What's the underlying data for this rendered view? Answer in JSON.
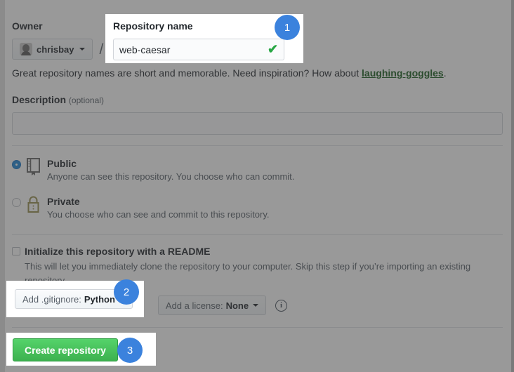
{
  "form": {
    "owner_label": "Owner",
    "owner_name": "chrisbay",
    "separator": "/",
    "repo_name_label": "Repository name",
    "repo_name_value": "web-caesar",
    "repo_name_placeholder": "",
    "valid_check": "✔",
    "hint_prefix": "Great repository names are short and memorable. Need inspiration? How about ",
    "hint_suggestion": "laughing-goggles",
    "hint_suffix": ".",
    "description_label": "Description",
    "description_optional": "(optional)",
    "description_value": "",
    "description_placeholder": ""
  },
  "visibility": {
    "public": {
      "title": "Public",
      "description": "Anyone can see this repository. You choose who can commit.",
      "selected": true
    },
    "private": {
      "title": "Private",
      "description": "You choose who can see and commit to this repository.",
      "selected": false
    }
  },
  "readme": {
    "title": "Initialize this repository with a README",
    "description": "This will let you immediately clone the repository to your computer. Skip this step if you’re importing an existing repository.",
    "checked": false
  },
  "options": {
    "gitignore_prefix": "Add .gitignore: ",
    "gitignore_value": "Python",
    "license_prefix": "Add a license: ",
    "license_value": "None",
    "info_icon_glyph": "i"
  },
  "actions": {
    "create_label": "Create repository"
  },
  "callouts": [
    {
      "number": "1",
      "target": "repository-name-field"
    },
    {
      "number": "2",
      "target": "gitignore-dropdown"
    },
    {
      "number": "3",
      "target": "create-repository-button"
    }
  ],
  "colors": {
    "accent_blue": "#3b82dd",
    "success_green": "#28a745",
    "button_green": "#3cb14f",
    "link_green": "#1b5e20",
    "dim_overlay": "#808080",
    "text_primary": "#24292e",
    "text_muted": "#586069",
    "border": "#d1d5da"
  }
}
